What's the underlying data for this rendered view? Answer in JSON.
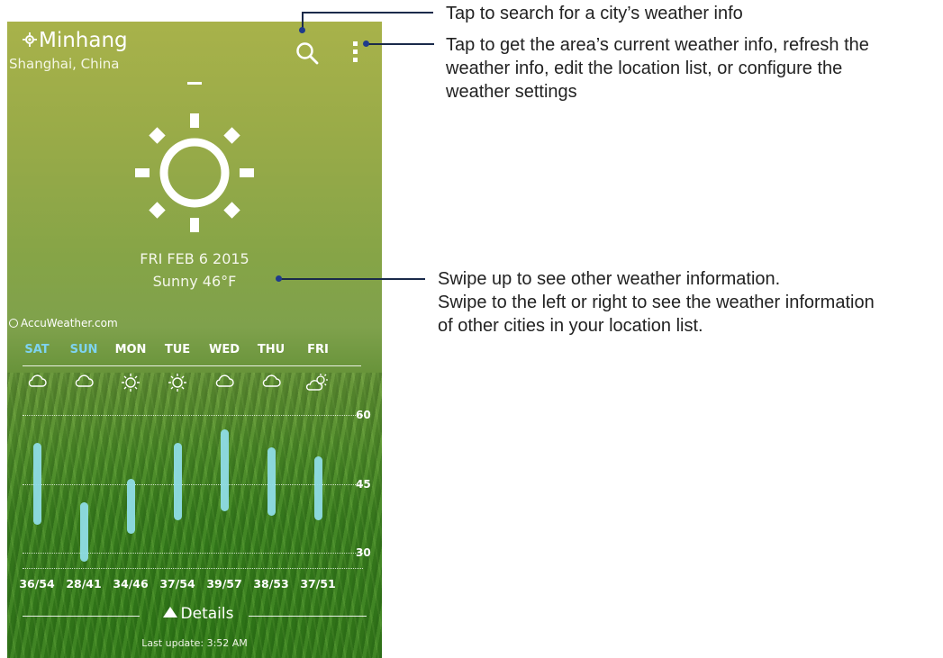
{
  "header": {
    "location_name": "Minhang",
    "location_region": "Shanghai, China"
  },
  "current": {
    "date": "FRI FEB 6 2015",
    "condition": "Sunny 46°F",
    "icon": "sun-icon"
  },
  "brand": "AccuWeather.com",
  "forecast": {
    "days": [
      {
        "day": "SAT",
        "weekend": true,
        "icon": "cloud-icon",
        "range": "36/54",
        "low": 36,
        "high": 54
      },
      {
        "day": "SUN",
        "weekend": true,
        "icon": "cloud-icon",
        "range": "28/41",
        "low": 28,
        "high": 41
      },
      {
        "day": "MON",
        "weekend": false,
        "icon": "sun-small-icon",
        "range": "34/46",
        "low": 34,
        "high": 46
      },
      {
        "day": "TUE",
        "weekend": false,
        "icon": "sun-small-icon",
        "range": "37/54",
        "low": 37,
        "high": 54
      },
      {
        "day": "WED",
        "weekend": false,
        "icon": "cloud-icon",
        "range": "39/57",
        "low": 39,
        "high": 57
      },
      {
        "day": "THU",
        "weekend": false,
        "icon": "cloud-icon",
        "range": "38/53",
        "low": 38,
        "high": 53
      },
      {
        "day": "FRI",
        "weekend": false,
        "icon": "partly-cloudy-icon",
        "range": "37/51",
        "low": 37,
        "high": 51
      }
    ],
    "axis_ticks": [
      "60",
      "45",
      "30"
    ],
    "axis_range": [
      26,
      64
    ]
  },
  "footer": {
    "details_label": "Details",
    "last_update": "Last update: 3:52 AM"
  },
  "callouts": {
    "search": "Tap to search for a city’s weather info",
    "menu": [
      "Tap to get the area’s current weather info, refresh the",
      "weather info, edit the location list, or configure the",
      "weather settings"
    ],
    "swipe": [
      "Swipe up to see other weather information.",
      "Swipe to the left or right to see the weather information",
      "of other cities in your location list."
    ]
  },
  "colors": {
    "weekend_day": "#7ed3f0",
    "temp_bar": "#8fdce6",
    "callout_dot": "#1f3b8c"
  }
}
